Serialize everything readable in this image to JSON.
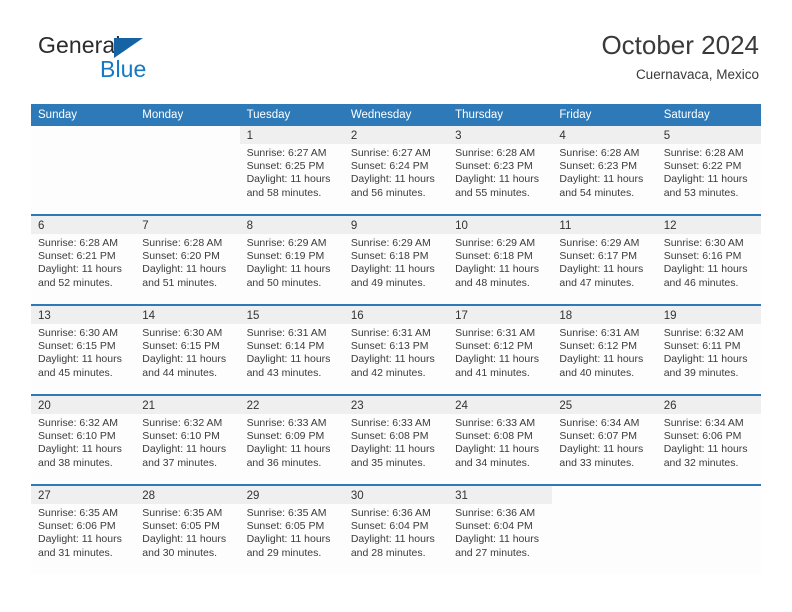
{
  "brand": {
    "name_part1": "General",
    "name_part2": "Blue",
    "logo_icon": "triangle-logo-icon",
    "accent_color": "#1479c4"
  },
  "header": {
    "title": "October 2024",
    "subtitle": "Cuernavaca, Mexico"
  },
  "calendar": {
    "header_bg": "#2e7ab8",
    "row_border_color": "#2e7ab8",
    "daynum_band_bg": "#efefef",
    "weekdays": [
      "Sunday",
      "Monday",
      "Tuesday",
      "Wednesday",
      "Thursday",
      "Friday",
      "Saturday"
    ],
    "weeks": [
      [
        {
          "day": "",
          "blank": true,
          "lines": []
        },
        {
          "day": "",
          "blank": true,
          "lines": []
        },
        {
          "day": "1",
          "lines": [
            "Sunrise: 6:27 AM",
            "Sunset: 6:25 PM",
            "Daylight: 11 hours",
            "and 58 minutes."
          ]
        },
        {
          "day": "2",
          "lines": [
            "Sunrise: 6:27 AM",
            "Sunset: 6:24 PM",
            "Daylight: 11 hours",
            "and 56 minutes."
          ]
        },
        {
          "day": "3",
          "lines": [
            "Sunrise: 6:28 AM",
            "Sunset: 6:23 PM",
            "Daylight: 11 hours",
            "and 55 minutes."
          ]
        },
        {
          "day": "4",
          "lines": [
            "Sunrise: 6:28 AM",
            "Sunset: 6:23 PM",
            "Daylight: 11 hours",
            "and 54 minutes."
          ]
        },
        {
          "day": "5",
          "lines": [
            "Sunrise: 6:28 AM",
            "Sunset: 6:22 PM",
            "Daylight: 11 hours",
            "and 53 minutes."
          ]
        }
      ],
      [
        {
          "day": "6",
          "lines": [
            "Sunrise: 6:28 AM",
            "Sunset: 6:21 PM",
            "Daylight: 11 hours",
            "and 52 minutes."
          ]
        },
        {
          "day": "7",
          "lines": [
            "Sunrise: 6:28 AM",
            "Sunset: 6:20 PM",
            "Daylight: 11 hours",
            "and 51 minutes."
          ]
        },
        {
          "day": "8",
          "lines": [
            "Sunrise: 6:29 AM",
            "Sunset: 6:19 PM",
            "Daylight: 11 hours",
            "and 50 minutes."
          ]
        },
        {
          "day": "9",
          "lines": [
            "Sunrise: 6:29 AM",
            "Sunset: 6:18 PM",
            "Daylight: 11 hours",
            "and 49 minutes."
          ]
        },
        {
          "day": "10",
          "lines": [
            "Sunrise: 6:29 AM",
            "Sunset: 6:18 PM",
            "Daylight: 11 hours",
            "and 48 minutes."
          ]
        },
        {
          "day": "11",
          "lines": [
            "Sunrise: 6:29 AM",
            "Sunset: 6:17 PM",
            "Daylight: 11 hours",
            "and 47 minutes."
          ]
        },
        {
          "day": "12",
          "lines": [
            "Sunrise: 6:30 AM",
            "Sunset: 6:16 PM",
            "Daylight: 11 hours",
            "and 46 minutes."
          ]
        }
      ],
      [
        {
          "day": "13",
          "lines": [
            "Sunrise: 6:30 AM",
            "Sunset: 6:15 PM",
            "Daylight: 11 hours",
            "and 45 minutes."
          ]
        },
        {
          "day": "14",
          "lines": [
            "Sunrise: 6:30 AM",
            "Sunset: 6:15 PM",
            "Daylight: 11 hours",
            "and 44 minutes."
          ]
        },
        {
          "day": "15",
          "lines": [
            "Sunrise: 6:31 AM",
            "Sunset: 6:14 PM",
            "Daylight: 11 hours",
            "and 43 minutes."
          ]
        },
        {
          "day": "16",
          "lines": [
            "Sunrise: 6:31 AM",
            "Sunset: 6:13 PM",
            "Daylight: 11 hours",
            "and 42 minutes."
          ]
        },
        {
          "day": "17",
          "lines": [
            "Sunrise: 6:31 AM",
            "Sunset: 6:12 PM",
            "Daylight: 11 hours",
            "and 41 minutes."
          ]
        },
        {
          "day": "18",
          "lines": [
            "Sunrise: 6:31 AM",
            "Sunset: 6:12 PM",
            "Daylight: 11 hours",
            "and 40 minutes."
          ]
        },
        {
          "day": "19",
          "lines": [
            "Sunrise: 6:32 AM",
            "Sunset: 6:11 PM",
            "Daylight: 11 hours",
            "and 39 minutes."
          ]
        }
      ],
      [
        {
          "day": "20",
          "lines": [
            "Sunrise: 6:32 AM",
            "Sunset: 6:10 PM",
            "Daylight: 11 hours",
            "and 38 minutes."
          ]
        },
        {
          "day": "21",
          "lines": [
            "Sunrise: 6:32 AM",
            "Sunset: 6:10 PM",
            "Daylight: 11 hours",
            "and 37 minutes."
          ]
        },
        {
          "day": "22",
          "lines": [
            "Sunrise: 6:33 AM",
            "Sunset: 6:09 PM",
            "Daylight: 11 hours",
            "and 36 minutes."
          ]
        },
        {
          "day": "23",
          "lines": [
            "Sunrise: 6:33 AM",
            "Sunset: 6:08 PM",
            "Daylight: 11 hours",
            "and 35 minutes."
          ]
        },
        {
          "day": "24",
          "lines": [
            "Sunrise: 6:33 AM",
            "Sunset: 6:08 PM",
            "Daylight: 11 hours",
            "and 34 minutes."
          ]
        },
        {
          "day": "25",
          "lines": [
            "Sunrise: 6:34 AM",
            "Sunset: 6:07 PM",
            "Daylight: 11 hours",
            "and 33 minutes."
          ]
        },
        {
          "day": "26",
          "lines": [
            "Sunrise: 6:34 AM",
            "Sunset: 6:06 PM",
            "Daylight: 11 hours",
            "and 32 minutes."
          ]
        }
      ],
      [
        {
          "day": "27",
          "lines": [
            "Sunrise: 6:35 AM",
            "Sunset: 6:06 PM",
            "Daylight: 11 hours",
            "and 31 minutes."
          ]
        },
        {
          "day": "28",
          "lines": [
            "Sunrise: 6:35 AM",
            "Sunset: 6:05 PM",
            "Daylight: 11 hours",
            "and 30 minutes."
          ]
        },
        {
          "day": "29",
          "lines": [
            "Sunrise: 6:35 AM",
            "Sunset: 6:05 PM",
            "Daylight: 11 hours",
            "and 29 minutes."
          ]
        },
        {
          "day": "30",
          "lines": [
            "Sunrise: 6:36 AM",
            "Sunset: 6:04 PM",
            "Daylight: 11 hours",
            "and 28 minutes."
          ]
        },
        {
          "day": "31",
          "lines": [
            "Sunrise: 6:36 AM",
            "Sunset: 6:04 PM",
            "Daylight: 11 hours",
            "and 27 minutes."
          ]
        },
        {
          "day": "",
          "blank": true,
          "lines": []
        },
        {
          "day": "",
          "blank": true,
          "lines": []
        }
      ]
    ]
  }
}
